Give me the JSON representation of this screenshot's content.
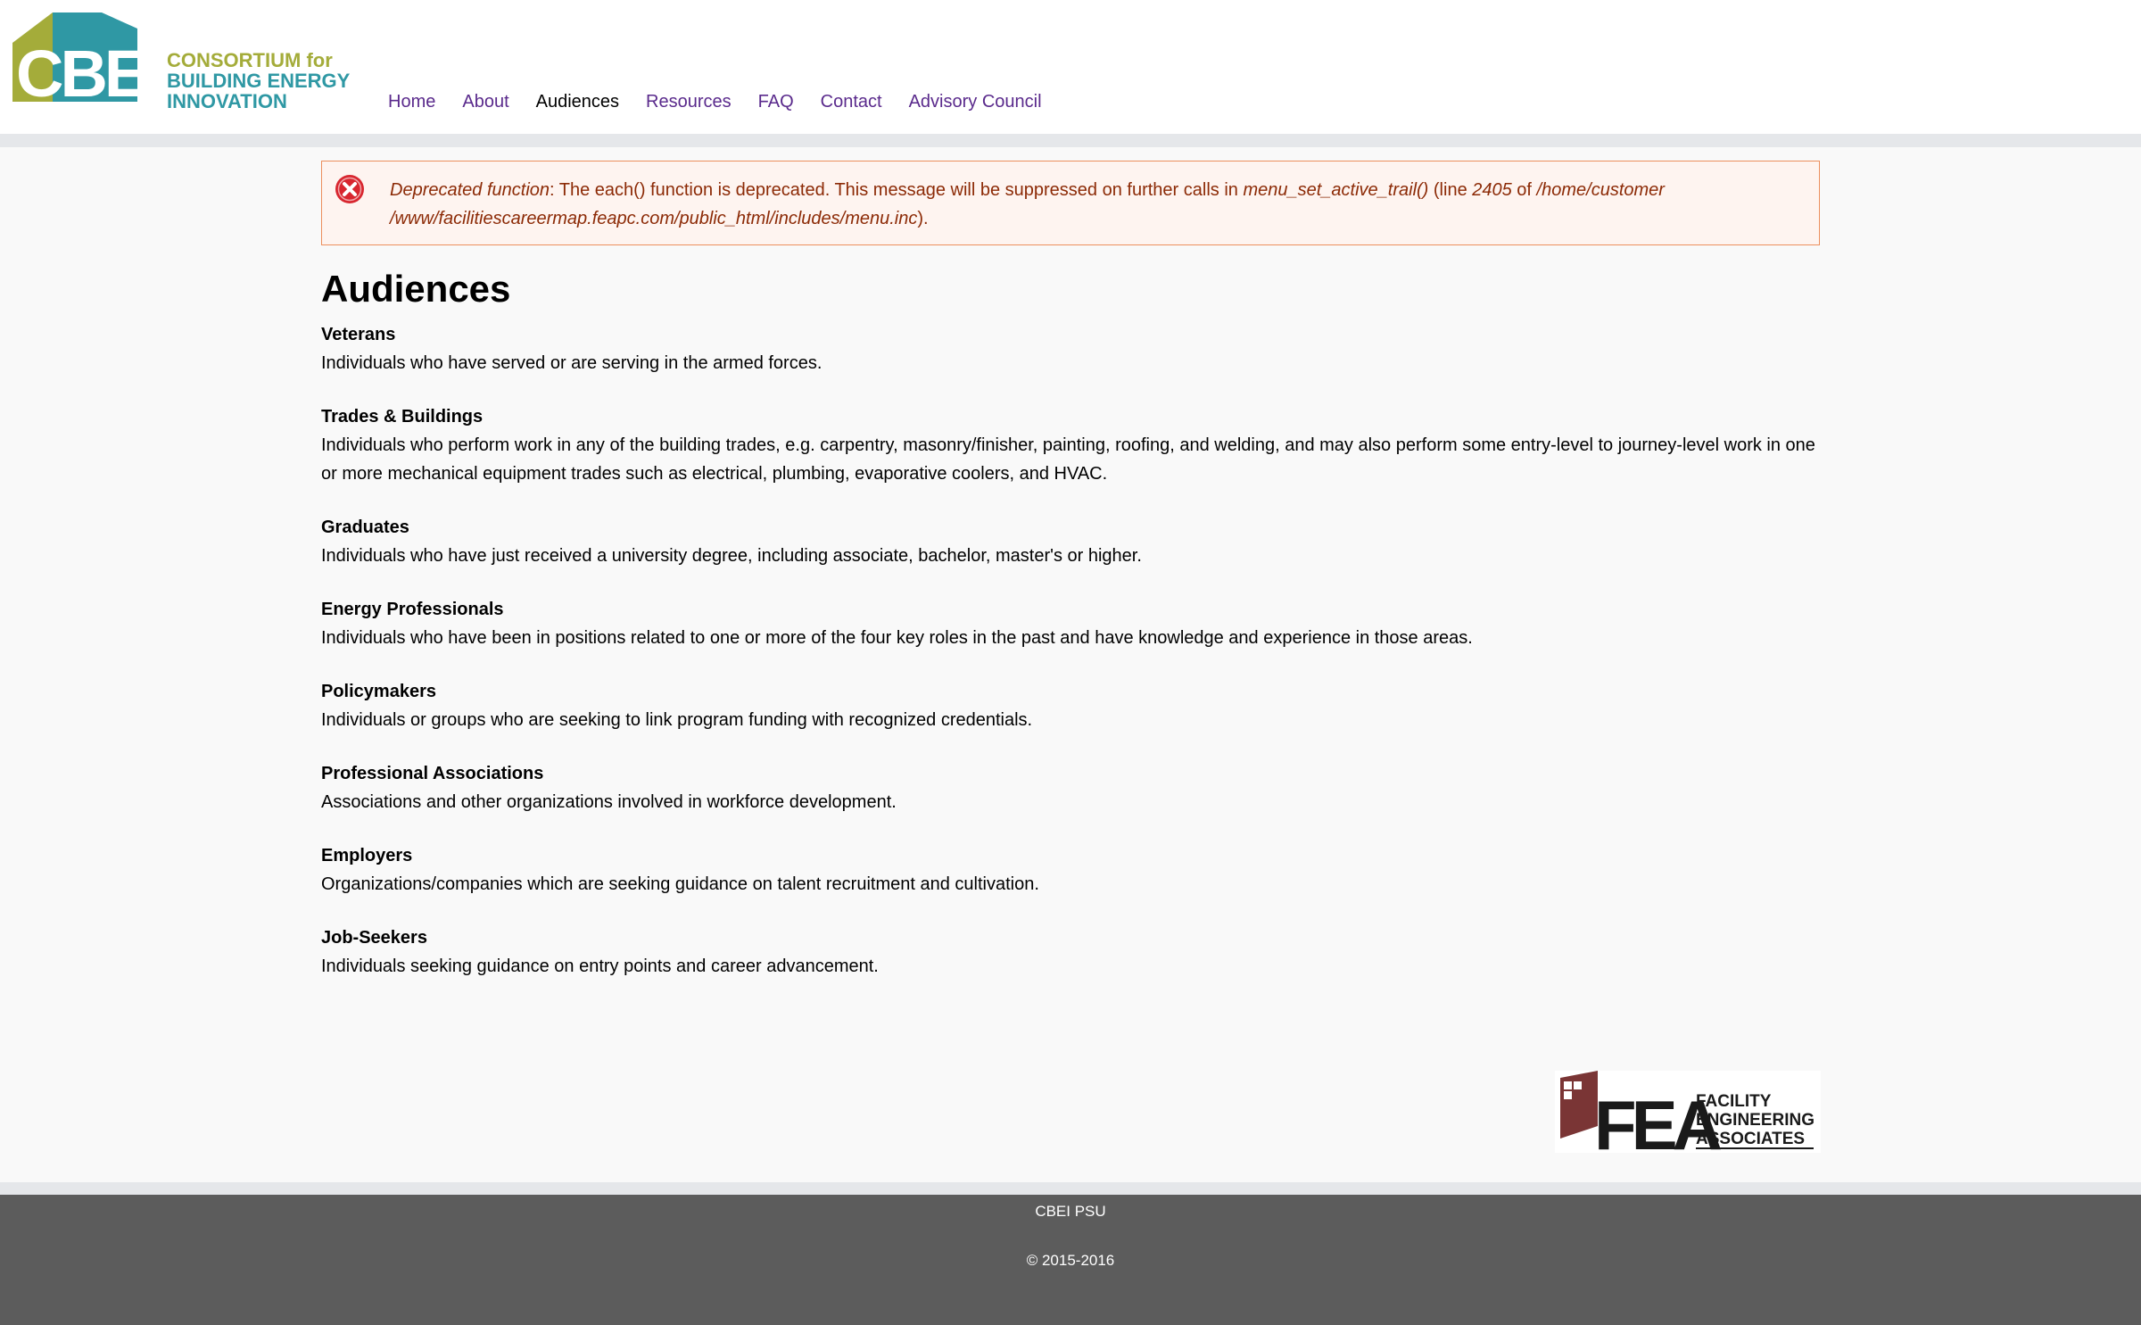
{
  "brand": {
    "logo_mark": "CBEi",
    "line1": "CONSORTIUM for",
    "line2": "BUILDING ENERGY",
    "line3": "INNOVATION",
    "colors": {
      "green": "#a4ac3a",
      "teal": "#2f98a4"
    }
  },
  "nav": {
    "items": [
      {
        "label": "Home"
      },
      {
        "label": "About"
      },
      {
        "label": "Audiences",
        "active": true
      },
      {
        "label": "Resources"
      },
      {
        "label": "FAQ"
      },
      {
        "label": "Contact"
      },
      {
        "label": "Advisory Council"
      }
    ],
    "link_color": "#5a2a8c"
  },
  "error": {
    "icon": "error-x-icon",
    "type": "Deprecated function",
    "text1": ": The each() function is deprecated. This message will be suppressed on further calls in ",
    "func": "menu_set_active_trail()",
    "text2": " (line ",
    "line": "2405",
    "text3": " of ",
    "path": "/home/customer /www/facilitiescareermap.feapc.com/public_html/includes/menu.inc",
    "text4": ")."
  },
  "page": {
    "title": "Audiences",
    "audiences": [
      {
        "title": "Veterans",
        "desc": "Individuals who have served or are serving in the armed forces."
      },
      {
        "title": "Trades & Buildings",
        "desc": "Individuals who perform work in any of the building trades, e.g. carpentry, masonry/finisher, painting, roofing, and welding, and may also perform some entry-level to journey-level work in one or more mechanical equipment trades such as electrical, plumbing, evaporative coolers, and HVAC."
      },
      {
        "title": "Graduates",
        "desc": "Individuals who have just received a university degree, including associate, bachelor, master's or higher."
      },
      {
        "title": "Energy Professionals",
        "desc": "Individuals who have been in positions related to one or more of the four key roles in the past and have knowledge and experience in those areas."
      },
      {
        "title": "Policymakers",
        "desc": "Individuals or groups who are seeking to link program funding with recognized credentials."
      },
      {
        "title": "Professional Associations",
        "desc": "Associations and other organizations involved in workforce development."
      },
      {
        "title": "Employers",
        "desc": "Organizations/companies which are seeking guidance on talent recruitment and cultivation."
      },
      {
        "title": "Job-Seekers",
        "desc": "Individuals seeking guidance on entry points and career advancement."
      }
    ]
  },
  "partner": {
    "mark": "FEA",
    "line1": "FACILITY",
    "line2": "ENGINEERING",
    "line3": "ASSOCIATES",
    "color": "#7a3535"
  },
  "footer": {
    "org": "CBEI PSU",
    "copyright": "© 2015-2016"
  }
}
